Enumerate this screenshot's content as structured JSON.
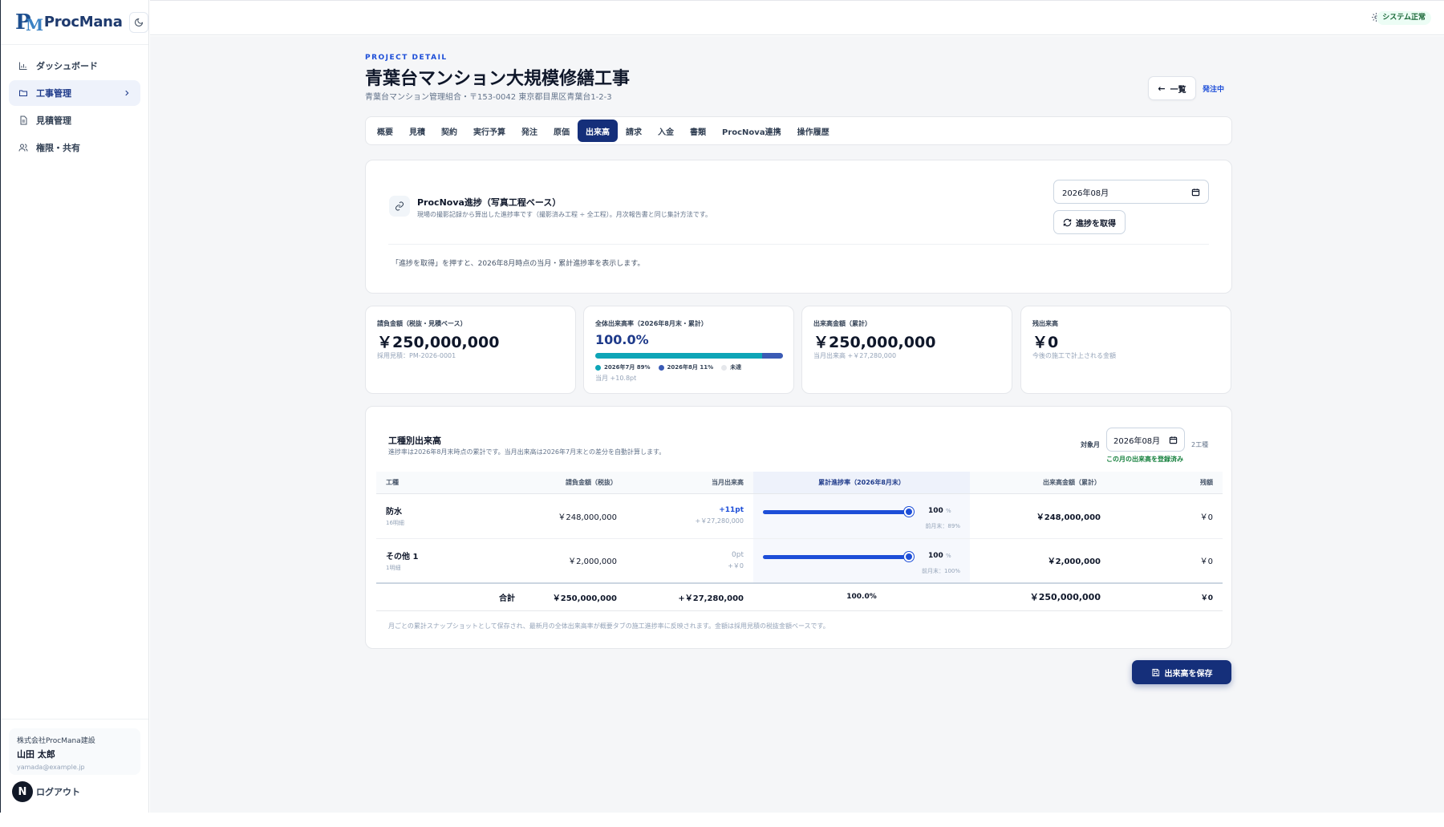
{
  "brand": {
    "name": "ProcMana"
  },
  "sidebar": {
    "items": [
      {
        "label": "ダッシュボード"
      },
      {
        "label": "工事管理"
      },
      {
        "label": "見積管理"
      },
      {
        "label": "権限・共有"
      }
    ],
    "user": {
      "org": "株式会社ProcMana建設",
      "name": "山田 太郎",
      "email": "yamada@example.jp"
    },
    "avatar_letter": "N",
    "logout_label": "ログアウト"
  },
  "header": {
    "status_badge": "システム正常"
  },
  "project": {
    "eyebrow": "PROJECT DETAIL",
    "title": "青葉台マンション大規模修繕工事",
    "subtitle": "青葉台マンション管理組合・〒153-0042 東京都目黒区青葉台1-2-3",
    "back_label": "一覧",
    "status": "発注中"
  },
  "tabs": [
    {
      "label": "概要"
    },
    {
      "label": "見積"
    },
    {
      "label": "契約"
    },
    {
      "label": "実行予算"
    },
    {
      "label": "発注"
    },
    {
      "label": "原価"
    },
    {
      "label": "出来高",
      "active": true
    },
    {
      "label": "請求"
    },
    {
      "label": "入金"
    },
    {
      "label": "書類"
    },
    {
      "label": "ProcNova連携"
    },
    {
      "label": "操作履歴"
    }
  ],
  "nova": {
    "title": "ProcNova進捗（写真工程ベース）",
    "description": "現場の撮影記録から算出した進捗率です（撮影済み工程 ÷ 全工程）。月次報告書と同じ集計方法です。",
    "month_value": "2026年08月",
    "fetch_label": "進捗を取得",
    "hint": "「進捗を取得」を押すと、2026年8月時点の当月・累計進捗率を表示します。"
  },
  "stats": {
    "contract": {
      "label": "請負金額（税抜・見積ベース）",
      "value": "￥250,000,000",
      "sub": "採用見積：PM-2026-0001"
    },
    "overall": {
      "label": "全体出来高率（2026年8月末・累計）",
      "value": "100.0%",
      "prev_pct": 89,
      "curr_pct": 11,
      "legend_prev": "2026年7月 89%",
      "legend_curr": "2026年8月 11%",
      "legend_rest": "未達",
      "sub": "当月 +10.8pt",
      "colors": {
        "prev": "#0ea5b7",
        "curr": "#3b5bb5",
        "rest": "#e5e7eb"
      }
    },
    "earned": {
      "label": "出来高金額（累計）",
      "value": "￥250,000,000",
      "sub": "当月出来高 +￥27,280,000"
    },
    "remaining": {
      "label": "残出来高",
      "value": "￥0",
      "sub": "今後の施工で計上される金額"
    }
  },
  "trade": {
    "title": "工種別出来高",
    "description": "進捗率は2026年8月末時点の累計です。当月出来高は2026年7月末との差分を自動計算します。",
    "target_label": "対象月",
    "month_value": "2026年08月",
    "kinds": "2工種",
    "registered": "この月の出来高を登録済み",
    "columns": [
      "工種",
      "請負金額（税抜）",
      "当月出来高",
      "累計進捗率（2026年8月末）",
      "出来高金額（累計）",
      "残額"
    ],
    "rows": [
      {
        "name": "防水",
        "count": "16明細",
        "contract": "￥248,000,000",
        "month_pt": "+11pt",
        "month_amt": "+￥27,280,000",
        "progress": 100,
        "progress_label": "100",
        "unit": "%",
        "prev": "前月末：89%",
        "earned": "￥248,000,000",
        "remaining": "￥0"
      },
      {
        "name": "その他 1",
        "count": "1明細",
        "contract": "￥2,000,000",
        "month_pt": "0pt",
        "month_amt": "+￥0",
        "progress": 100,
        "progress_label": "100",
        "unit": "%",
        "prev": "前月末：100%",
        "earned": "￥2,000,000",
        "remaining": "￥0"
      }
    ],
    "total": {
      "label": "合計",
      "contract": "￥250,000,000",
      "month_amt": "+￥27,280,000",
      "progress": "100.0%",
      "earned": "￥250,000,000",
      "remaining": "￥0"
    },
    "footnote": "月ごとの累計スナップショットとして保存され、最新月の全体出来高率が概要タブの施工進捗率に反映されます。金額は採用見積の税抜金額ベースです。"
  },
  "save_label": "出来高を保存"
}
